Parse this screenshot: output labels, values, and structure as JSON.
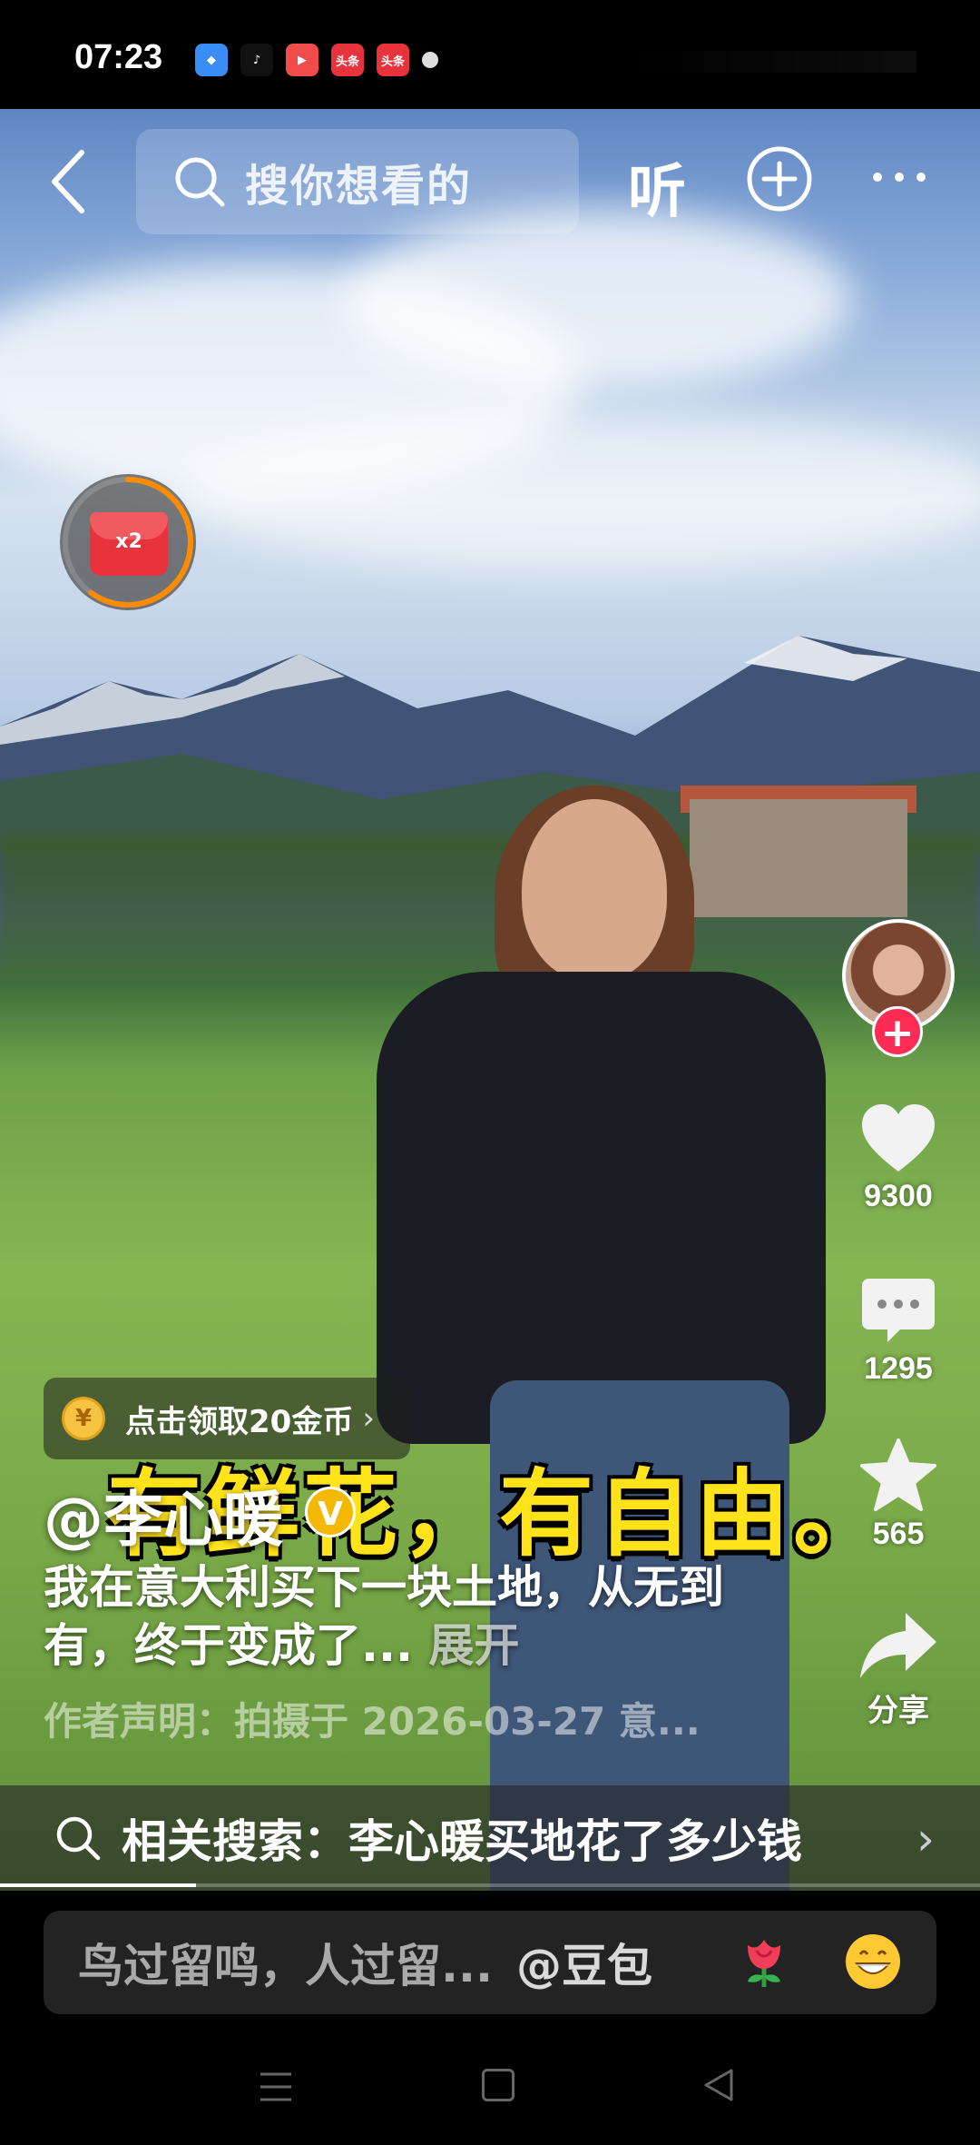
{
  "status_bar": {
    "time": "07:23",
    "notification_icons": [
      "browser-icon",
      "tiktok-icon",
      "video-icon",
      "toutiao-icon",
      "toutiao-icon"
    ],
    "toutiao_label": "头条"
  },
  "top_bar": {
    "search_placeholder": "搜你想看的",
    "listen_label": "听"
  },
  "red_packet": {
    "multiplier": "x2",
    "progress": 0.6
  },
  "actions": {
    "likes": "9300",
    "comments": "1295",
    "favorites": "565",
    "share_label": "分享"
  },
  "coin_reward": {
    "label": "点击领取20金币",
    "coin_symbol": "¥"
  },
  "video_subtitle": "有鲜花，有自由。",
  "caption": {
    "username": "@李心暖",
    "verified_mark": "V",
    "description": "我在意大利买下一块土地，从无到有，终于变成了...",
    "expand_label": "展开",
    "declaration": "作者声明：拍摄于 2026-03-27 意..."
  },
  "related_search": {
    "label": "相关搜索：李心暖买地花了多少钱"
  },
  "video_progress": 0.2,
  "comment_bar": {
    "placeholder": "鸟过留鸣，人过留...",
    "mention": "@豆包"
  },
  "colors": {
    "accent": "#fe2c55",
    "subtitle_yellow": "#ffe31a",
    "coin_gold": "#f6c343"
  }
}
